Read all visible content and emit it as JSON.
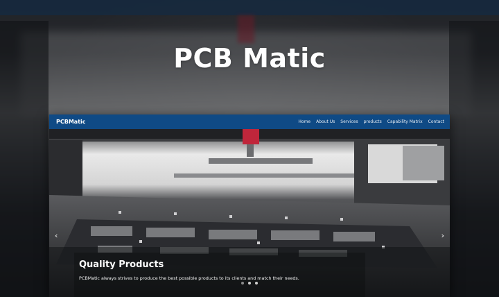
{
  "hero": {
    "title": "PCB Matic"
  },
  "site": {
    "brand": "PCBMatic",
    "nav": [
      "Home",
      "About Us",
      "Services",
      "products",
      "Capability Matrix",
      "Contact"
    ]
  },
  "slide": {
    "title": "Quality Products",
    "text": "PCBMatic always strives to produce the best possible products to its clients and match their needs.",
    "prev_icon": "chevron-left-icon",
    "next_icon": "chevron-right-icon",
    "active_index": 1,
    "total": 3
  },
  "colors": {
    "navbar": "#0f4a85",
    "accent_red": "#c0263b"
  }
}
